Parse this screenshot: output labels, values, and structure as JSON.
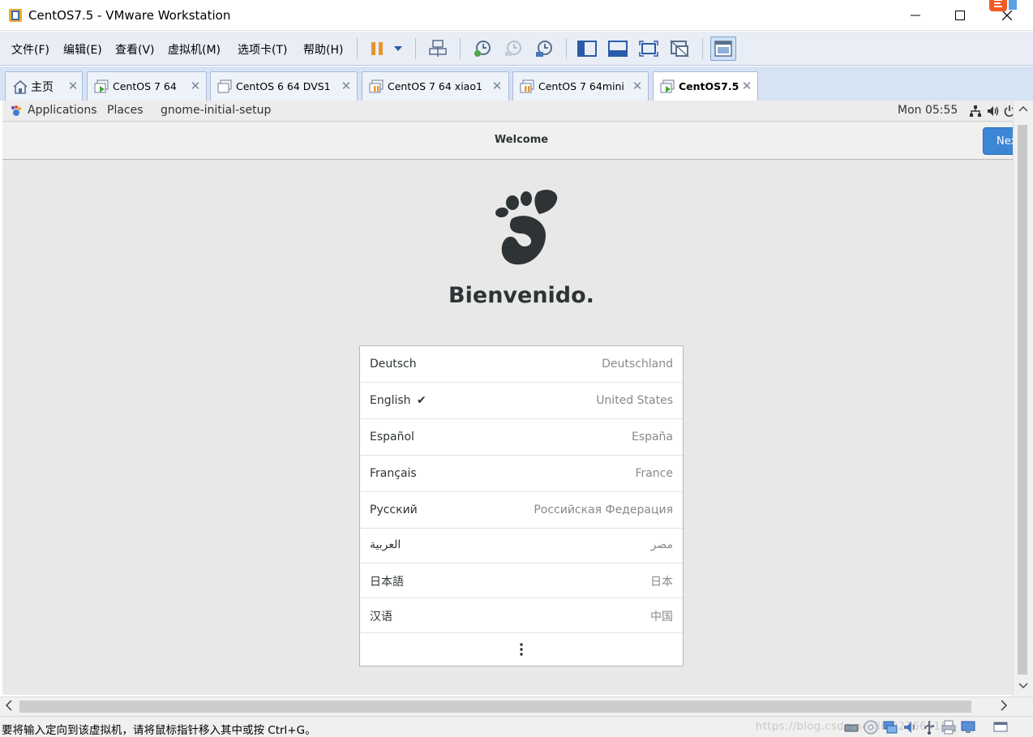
{
  "window": {
    "title": "CentOS7.5 - VMware Workstation",
    "icons": [
      "vmware-app-icon",
      "minimize-icon",
      "maximize-icon",
      "close-icon"
    ]
  },
  "menu": {
    "items": [
      "文件(F)",
      "编辑(E)",
      "查看(V)",
      "虚拟机(M)",
      "选项卡(T)",
      "帮助(H)"
    ]
  },
  "toolbar": {
    "icons": [
      "pause-icon",
      "dropdown-arrow-icon",
      "send-ctrl-alt-del-icon",
      "snapshot-take-icon",
      "snapshot-revert-icon",
      "snapshot-manager-icon",
      "show-library-icon",
      "thumbnail-bar-icon",
      "full-screen-icon",
      "unity-icon",
      "console-view-icon"
    ]
  },
  "tabs": [
    {
      "label": "主页",
      "icon": "home-icon",
      "active": false
    },
    {
      "label": "CentOS 7 64",
      "icon": "vm-running-icon",
      "active": false
    },
    {
      "label": "CentOS 6 64 DVS1",
      "icon": "vm-icon",
      "active": false
    },
    {
      "label": "CentOS 7 64 xiao1",
      "icon": "vm-suspended-icon",
      "active": false
    },
    {
      "label": "CentOS 7 64mini",
      "icon": "vm-suspended-icon",
      "active": false
    },
    {
      "label": "CentOS7.5",
      "icon": "vm-running-icon",
      "active": true
    }
  ],
  "gnome_panel": {
    "applications": "Applications",
    "places": "Places",
    "current_app": "gnome-initial-setup",
    "clock": "Mon 05:55",
    "icons": [
      "network-icon",
      "volume-icon",
      "power-icon"
    ]
  },
  "setup": {
    "header_title": "Welcome",
    "next_label": "Next",
    "welcome_text": "Bienvenido.",
    "languages": [
      {
        "name": "Deutsch",
        "region": "Deutschland",
        "selected": false
      },
      {
        "name": "English",
        "region": "United States",
        "selected": true
      },
      {
        "name": "Español",
        "region": "España",
        "selected": false
      },
      {
        "name": "Français",
        "region": "France",
        "selected": false
      },
      {
        "name": "Русский",
        "region": "Российская Федерация",
        "selected": false
      },
      {
        "name": "العربية",
        "region": "مصر",
        "selected": false
      },
      {
        "name": "日本語",
        "region": "日本",
        "selected": false
      },
      {
        "name": "汉语",
        "region": "中国",
        "selected": false
      }
    ],
    "check_glyph": "✔",
    "more_glyph": "⋮"
  },
  "statusbar": {
    "text": "要将输入定向到该虚拟机，请将鼠标指针移入其中或按 Ctrl+G。",
    "watermark": "https://blog.csdn.net/liu927665152",
    "icons": [
      "hard-disk-icon",
      "cd-dvd-icon",
      "network-adapter-icon",
      "sound-icon",
      "usb-icon",
      "printer-icon",
      "display-icon",
      "message-icon"
    ]
  },
  "colors": {
    "accent": "#3d86d5",
    "tab_strip": "#d6e3f5",
    "menubar": "#e9eef6",
    "guest_bg": "#e8e8e7"
  }
}
